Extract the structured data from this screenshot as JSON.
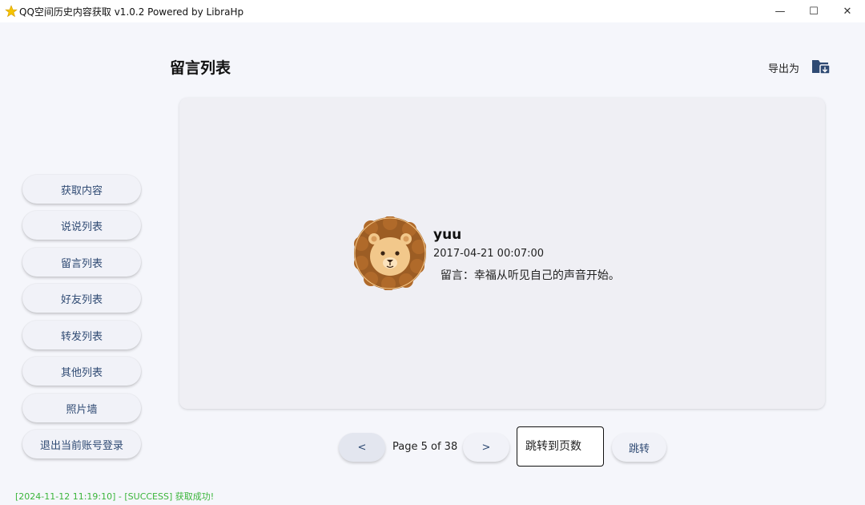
{
  "window": {
    "title": "QQ空间历史内容获取 v1.0.2 Powered by LibraHp",
    "minimize_glyph": "—",
    "maximize_glyph": "☐",
    "close_glyph": "✕"
  },
  "sidebar": {
    "items": [
      {
        "label": "获取内容"
      },
      {
        "label": "说说列表"
      },
      {
        "label": "留言列表"
      },
      {
        "label": "好友列表"
      },
      {
        "label": "转发列表"
      },
      {
        "label": "其他列表"
      },
      {
        "label": "照片墙"
      },
      {
        "label": "退出当前账号登录"
      }
    ]
  },
  "header": {
    "title": "留言列表",
    "export_label": "导出为",
    "export_icon": "folder-export-icon"
  },
  "message": {
    "username": "yuu",
    "timestamp": "2017-04-21 00:07:00",
    "text": "  留言：幸福从听见自己的声音开始。",
    "avatar_icon": "lion-avatar"
  },
  "pagination": {
    "prev_label": "<",
    "next_label": ">",
    "page_info": "Page 5 of 38",
    "jump_placeholder": "跳转到页数",
    "jump_label": "跳转"
  },
  "status": {
    "text": "[2024-11-12 11:19:10] - [SUCCESS] 获取成功!"
  },
  "colors": {
    "accent": "#2f4a73",
    "success": "#3bb53b",
    "background": "#f5f6fb"
  }
}
